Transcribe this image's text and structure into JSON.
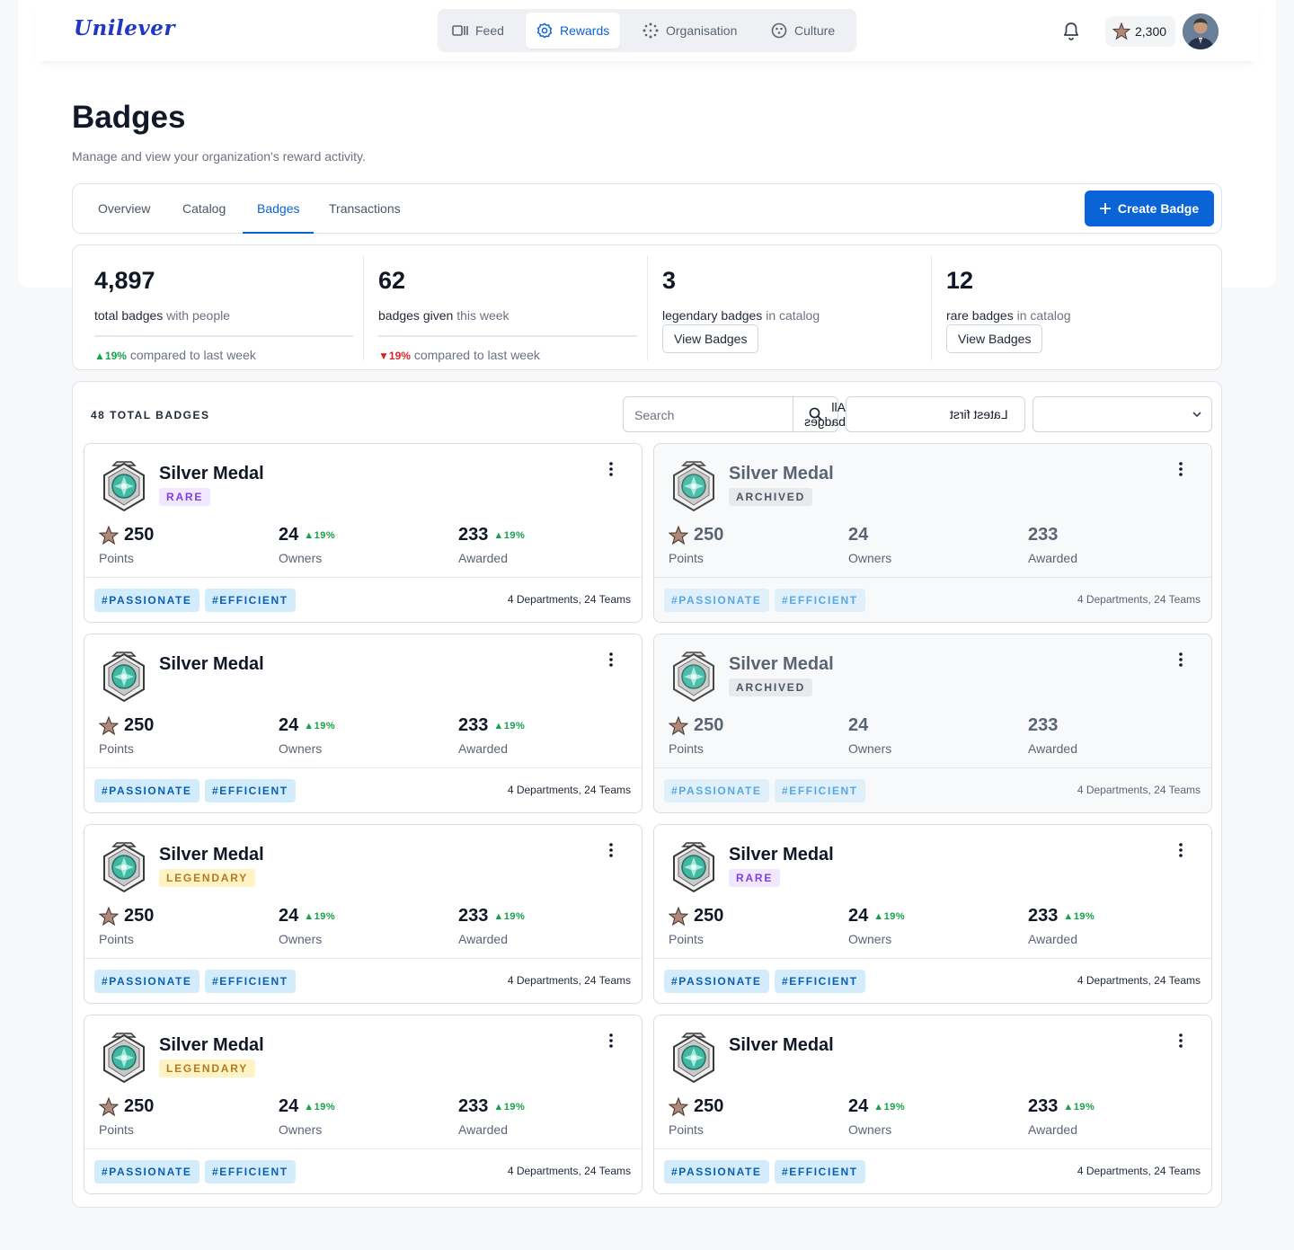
{
  "header": {
    "logo": "Unilever",
    "nav": [
      {
        "label": "Feed",
        "icon": "feed-icon"
      },
      {
        "label": "Rewards",
        "icon": "rewards-icon",
        "active": true
      },
      {
        "label": "Organisation",
        "icon": "organisation-icon"
      },
      {
        "label": "Culture",
        "icon": "culture-icon"
      }
    ],
    "points": "2,300"
  },
  "page": {
    "title": "Badges",
    "subtitle": "Manage and view your organization's reward activity."
  },
  "tabs": {
    "items": [
      "Overview",
      "Catalog",
      "Badges",
      "Transactions"
    ],
    "active": "Badges",
    "create_label": "Create Badge"
  },
  "stats": [
    {
      "value": "4,897",
      "label_strong": "total badges",
      "label_muted": "with people",
      "change": "19%",
      "direction": "up",
      "change_text": "compared to last week"
    },
    {
      "value": "62",
      "label_strong": "badges given",
      "label_muted": "this week",
      "change": "19%",
      "direction": "down",
      "change_text": "compared to last week"
    },
    {
      "value": "3",
      "label_strong": "legendary badges",
      "label_muted": "in catalog",
      "button": "View Badges"
    },
    {
      "value": "12",
      "label_strong": "rare badges",
      "label_muted": "in catalog",
      "button": "View Badges"
    }
  ],
  "list": {
    "total_label": "48 TOTAL BADGES",
    "search_placeholder": "Search",
    "filter_type": "All badges",
    "filter_sort": "Latest first"
  },
  "cards": [
    {
      "title": "Silver Medal",
      "tier": "RARE",
      "tier_style": "rare",
      "archived": false,
      "points": "250",
      "points_label": "Points",
      "owners": "24",
      "owners_label": "Owners",
      "owners_trend": "19%",
      "awarded": "233",
      "awarded_label": "Awarded",
      "awarded_trend": "19%",
      "tags": [
        "#PASSIONATE",
        "#EFFICIENT"
      ],
      "dept": "4 Departments, 24 Teams"
    },
    {
      "title": "Silver Medal",
      "tier": "ARCHIVED",
      "tier_style": "archived-tag",
      "archived": true,
      "points": "250",
      "points_label": "Points",
      "owners": "24",
      "owners_label": "Owners",
      "owners_trend": "",
      "awarded": "233",
      "awarded_label": "Awarded",
      "awarded_trend": "",
      "tags": [
        "#PASSIONATE",
        "#EFFICIENT"
      ],
      "dept": "4 Departments, 24 Teams"
    },
    {
      "title": "Silver Medal",
      "tier": "",
      "tier_style": "",
      "archived": false,
      "points": "250",
      "points_label": "Points",
      "owners": "24",
      "owners_label": "Owners",
      "owners_trend": "19%",
      "awarded": "233",
      "awarded_label": "Awarded",
      "awarded_trend": "19%",
      "tags": [
        "#PASSIONATE",
        "#EFFICIENT"
      ],
      "dept": "4 Departments, 24 Teams"
    },
    {
      "title": "Silver Medal",
      "tier": "ARCHIVED",
      "tier_style": "archived-tag",
      "archived": true,
      "points": "250",
      "points_label": "Points",
      "owners": "24",
      "owners_label": "Owners",
      "owners_trend": "",
      "awarded": "233",
      "awarded_label": "Awarded",
      "awarded_trend": "",
      "tags": [
        "#PASSIONATE",
        "#EFFICIENT"
      ],
      "dept": "4 Departments, 24 Teams"
    },
    {
      "title": "Silver Medal",
      "tier": "LEGENDARY",
      "tier_style": "legendary",
      "archived": false,
      "points": "250",
      "points_label": "Points",
      "owners": "24",
      "owners_label": "Owners",
      "owners_trend": "19%",
      "awarded": "233",
      "awarded_label": "Awarded",
      "awarded_trend": "19%",
      "tags": [
        "#PASSIONATE",
        "#EFFICIENT"
      ],
      "dept": "4 Departments, 24 Teams"
    },
    {
      "title": "Silver Medal",
      "tier": "RARE",
      "tier_style": "rare",
      "archived": false,
      "points": "250",
      "points_label": "Points",
      "owners": "24",
      "owners_label": "Owners",
      "owners_trend": "19%",
      "awarded": "233",
      "awarded_label": "Awarded",
      "awarded_trend": "19%",
      "tags": [
        "#PASSIONATE",
        "#EFFICIENT"
      ],
      "dept": "4 Departments, 24 Teams"
    },
    {
      "title": "Silver Medal",
      "tier": "LEGENDARY",
      "tier_style": "legendary",
      "archived": false,
      "points": "250",
      "points_label": "Points",
      "owners": "24",
      "owners_label": "Owners",
      "owners_trend": "19%",
      "awarded": "233",
      "awarded_label": "Awarded",
      "awarded_trend": "19%",
      "tags": [
        "#PASSIONATE",
        "#EFFICIENT"
      ],
      "dept": "4 Departments, 24 Teams"
    },
    {
      "title": "Silver Medal",
      "tier": "",
      "tier_style": "",
      "archived": false,
      "points": "250",
      "points_label": "Points",
      "owners": "24",
      "owners_label": "Owners",
      "owners_trend": "19%",
      "awarded": "233",
      "awarded_label": "Awarded",
      "awarded_trend": "19%",
      "tags": [
        "#PASSIONATE",
        "#EFFICIENT"
      ],
      "dept": "4 Departments, 24 Teams"
    }
  ],
  "colors": {
    "accent": "#0b63d8",
    "up": "#16a34a",
    "down": "#dc2626",
    "rare": "#7e3fe0",
    "legendary": "#b7791f"
  }
}
